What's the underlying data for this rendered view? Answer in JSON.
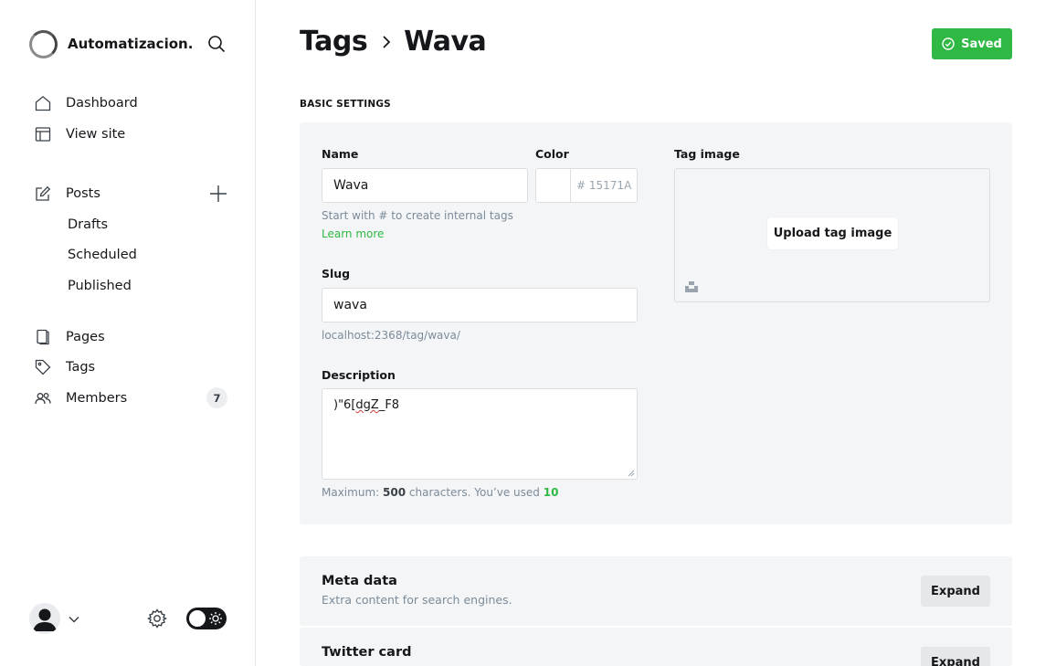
{
  "sidebar": {
    "site_title": "Automatizacion...",
    "nav": {
      "dashboard": "Dashboard",
      "view_site": "View site",
      "posts": "Posts",
      "drafts": "Drafts",
      "scheduled": "Scheduled",
      "published": "Published",
      "pages": "Pages",
      "tags": "Tags",
      "members": "Members",
      "members_count": "7"
    }
  },
  "header": {
    "breadcrumb_parent": "Tags",
    "breadcrumb_current": "Wava",
    "saved_label": "Saved"
  },
  "basic_settings": {
    "section_title": "BASIC SETTINGS",
    "name_label": "Name",
    "name_value": "Wava",
    "name_hint": "Start with # to create internal tags",
    "learn_more": "Learn more",
    "color_label": "Color",
    "color_hash": "#",
    "color_placeholder": "15171A",
    "slug_label": "Slug",
    "slug_value": "wava",
    "slug_url": "localhost:2368/tag/wava/",
    "description_label": "Description",
    "description_prefix": ")\"6[",
    "description_misspelled": "dgZ",
    "description_suffix": "_F8",
    "desc_hint_prefix": "Maximum:",
    "desc_hint_max": "500",
    "desc_hint_mid": "characters. You’ve used",
    "desc_hint_used": "10",
    "tag_image_label": "Tag image",
    "upload_label": "Upload tag image"
  },
  "meta_data": {
    "title": "Meta data",
    "subtitle": "Extra content for search engines.",
    "expand": "Expand"
  },
  "twitter_card": {
    "title": "Twitter card",
    "expand": "Expand"
  },
  "colors": {
    "accent_green": "#2fb843",
    "panel_bg": "#f4f5f6",
    "text_dark": "#15171a"
  }
}
